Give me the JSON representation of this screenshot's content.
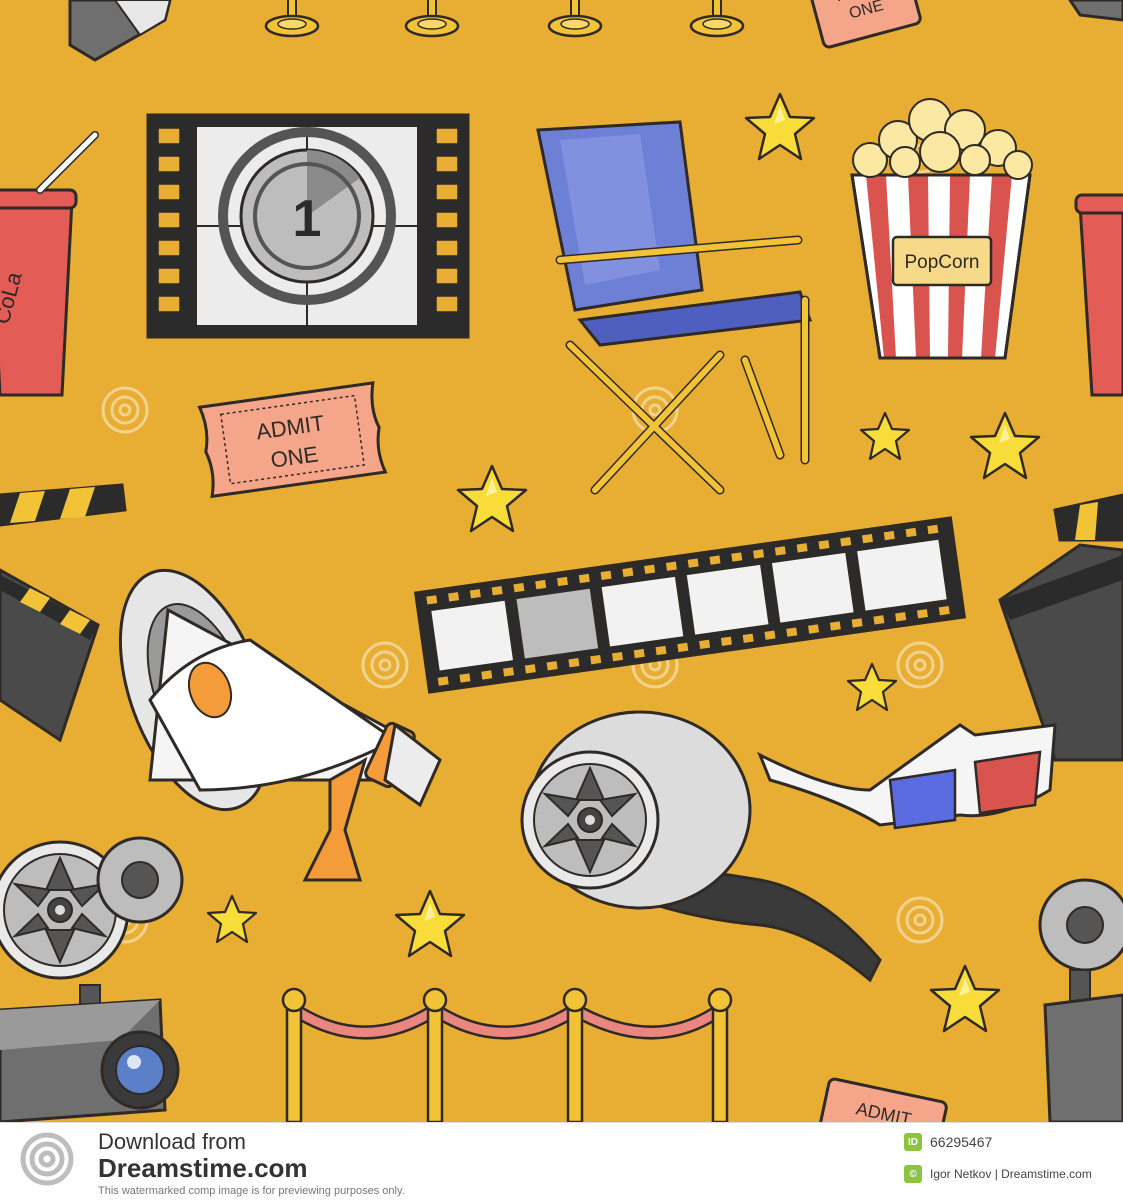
{
  "colors": {
    "background": "#e8ad33",
    "outline": "#2f2a25",
    "star": "#f8dc3a",
    "red": "#d9534f",
    "blue": "#6e7fd6",
    "rope": "#e9867f",
    "gold": "#f2c237",
    "footer_green": "#8cc43f"
  },
  "artwork": {
    "ticket_text_line1": "ADMIT",
    "ticket_text_line2": "ONE",
    "countdown_number": "1",
    "popcorn_label": "PopCorn",
    "cola_label": "CoLa",
    "watermark_text": "dreamstime"
  },
  "footer": {
    "download_from": "Download from",
    "brand": "Dreamstime.com",
    "note": "This watermarked comp image is for previewing purposes only.",
    "id_icon": "ID",
    "image_id": "66295467",
    "author_icon_name": "copyright-icon",
    "author": "Igor Netkov | Dreamstime.com"
  }
}
